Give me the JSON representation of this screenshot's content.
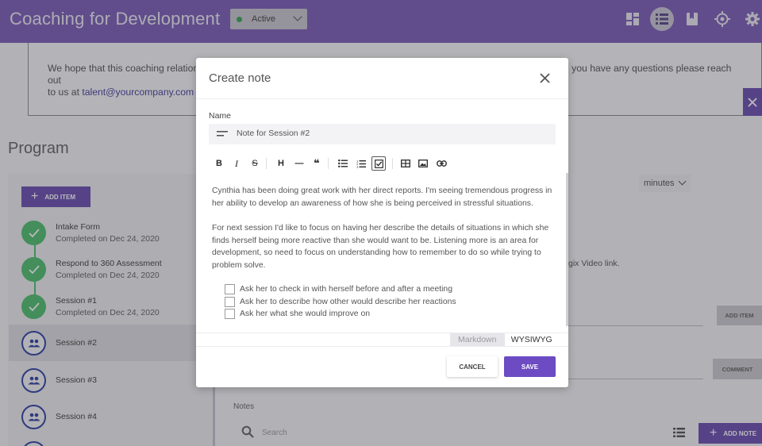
{
  "header": {
    "title": "Coaching for Development",
    "status": "Active",
    "icons": [
      "dashboard-icon",
      "list-icon",
      "bookmark-icon",
      "target-icon",
      "gear-icon"
    ]
  },
  "background": {
    "intro_text_before": "We hope that this coaching relation",
    "intro_text_after": "you have any questions please reach out",
    "intro_text_line2": "to us at ",
    "intro_email": "talent@yourcompany.com",
    "program_title": "Program",
    "add_item_label": "ADD ITEM",
    "steps": [
      {
        "title": "Intake Form",
        "subtitle": "Completed on Dec 24, 2020",
        "state": "done"
      },
      {
        "title": "Respond to 360 Assessment",
        "subtitle": "Completed on Dec 24, 2020",
        "state": "done"
      },
      {
        "title": "Session #1",
        "subtitle": "Completed on Dec 24, 2020",
        "state": "done"
      },
      {
        "title": "Session #2",
        "subtitle": "",
        "state": "selected"
      },
      {
        "title": "Session #3",
        "subtitle": "",
        "state": "todo"
      },
      {
        "title": "Session #4",
        "subtitle": "",
        "state": "todo"
      }
    ],
    "minutes_label": "minutes",
    "video_link_text": "gix Video link.",
    "add_item_right": "ADD ITEM",
    "comment_label": "COMMENT",
    "notes_label": "Notes",
    "search_placeholder": "Search",
    "add_note_label": "ADD NOTE"
  },
  "modal": {
    "title": "Create note",
    "name_label": "Name",
    "name_value": "Note for Session #2",
    "toolbar": [
      {
        "glyph": "B",
        "name": "bold-button"
      },
      {
        "glyph": "I",
        "name": "italic-button"
      },
      {
        "glyph": "S",
        "name": "strikethrough-button"
      },
      {
        "glyph": "H",
        "name": "heading-button"
      },
      {
        "glyph": "—",
        "name": "horizontal-rule-button"
      },
      {
        "glyph": "❝",
        "name": "quote-button"
      }
    ],
    "paragraph1": "Cynthia has been doing great work with her direct reports. I'm seeing tremendous progress in her ability to develop an awareness of how she is being perceived in stressful situations.",
    "paragraph2": "For next session I'd like to focus on having her describe the details of situations in which she finds herself being more reactive than she would want to be. Listening more is an area for development, so need to focus on understanding how to remember to do so while trying to problem solve.",
    "tasks": [
      "Ask her to check in with herself before and after a meeting",
      "Ask her to describe how other would describe her reactions",
      "Ask her what she would improve on"
    ],
    "mode_markdown": "Markdown",
    "mode_wysiwyg": "WYSIWYG",
    "cancel_label": "CANCEL",
    "save_label": "SAVE"
  }
}
